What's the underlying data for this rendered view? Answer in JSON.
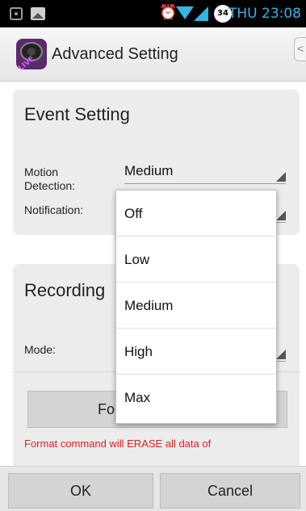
{
  "status_bar": {
    "battery_level": "34",
    "time": "THU 23:08",
    "icons": [
      "camera-notification-icon",
      "image-notification-icon",
      "alarm-icon",
      "wifi-icon",
      "signal-icon",
      "battery-icon"
    ]
  },
  "header": {
    "title": "Advanced Setting",
    "app_icon_text": "LIVE"
  },
  "event_setting": {
    "title": "Event Setting",
    "motion_label": "Motion Detection:",
    "motion_value": "Medium",
    "notification_label": "Notification:",
    "notification_value": ""
  },
  "recording": {
    "title": "Recording",
    "mode_label": "Mode:",
    "mode_value": ""
  },
  "format": {
    "button_label": "Fo",
    "warning": "Format command will ERASE all data of"
  },
  "dropdown": {
    "options": [
      "Off",
      "Low",
      "Medium",
      "High",
      "Max"
    ]
  },
  "footer": {
    "ok_label": "OK",
    "cancel_label": "Cancel"
  },
  "colors": {
    "accent": "#33b5e5",
    "warning": "#e01e1e",
    "card_bg": "#ececec"
  }
}
